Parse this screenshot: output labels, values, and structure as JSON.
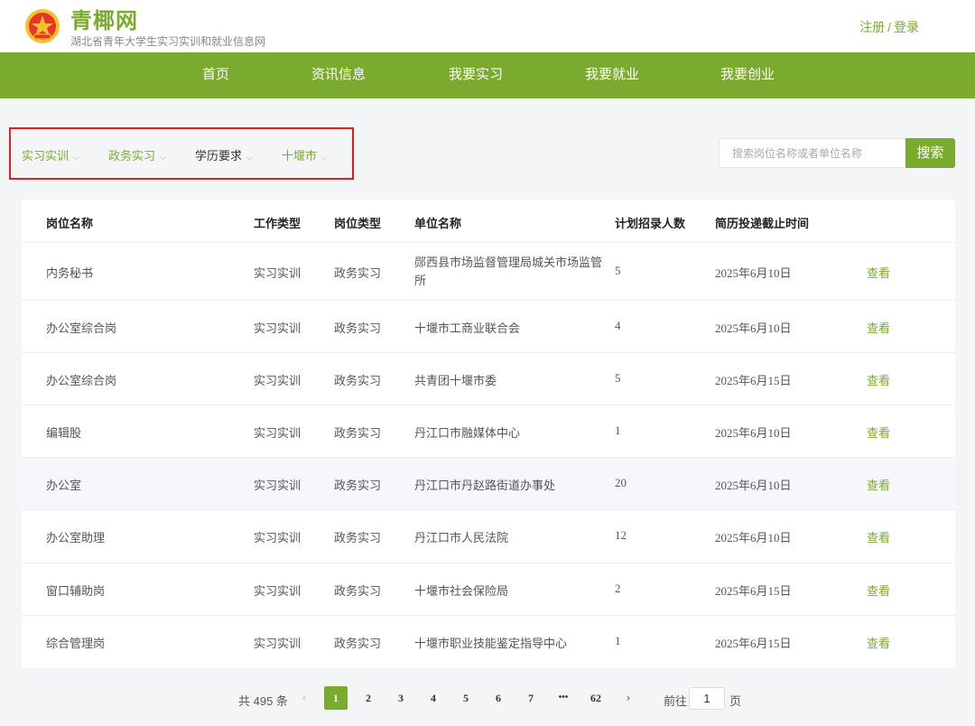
{
  "brand": {
    "name": "青椰网",
    "subtitle": "湖北省青年大学生实习实训和就业信息网",
    "accent": "#7aab2e"
  },
  "auth": {
    "register": "注册",
    "separator": "/",
    "login": "登录"
  },
  "nav": [
    "首页",
    "资讯信息",
    "我要实习",
    "我要就业",
    "我要创业"
  ],
  "filters": [
    "实习实训",
    "政务实习",
    "学历要求",
    "十堰市"
  ],
  "search": {
    "placeholder": "搜索岗位名称或者单位名称",
    "button": "搜索"
  },
  "table": {
    "headers": [
      "岗位名称",
      "工作类型",
      "岗位类型",
      "单位名称",
      "计划招录人数",
      "简历投递截止时间"
    ],
    "action": "查看",
    "rows": [
      {
        "post": "内务秘书",
        "work_type": "实习实训",
        "post_type": "政务实习",
        "org": "郧西县市场监督管理局城关市场监管所",
        "count": "5",
        "deadline": "2025年6月10日"
      },
      {
        "post": "办公室综合岗",
        "work_type": "实习实训",
        "post_type": "政务实习",
        "org": "十堰市工商业联合会",
        "count": "4",
        "deadline": "2025年6月10日"
      },
      {
        "post": "办公室综合岗",
        "work_type": "实习实训",
        "post_type": "政务实习",
        "org": "共青团十堰市委",
        "count": "5",
        "deadline": "2025年6月15日"
      },
      {
        "post": "编辑股",
        "work_type": "实习实训",
        "post_type": "政务实习",
        "org": "丹江口市融媒体中心",
        "count": "1",
        "deadline": "2025年6月10日"
      },
      {
        "post": "办公室",
        "work_type": "实习实训",
        "post_type": "政务实习",
        "org": "丹江口市丹赵路街道办事处",
        "count": "20",
        "deadline": "2025年6月10日"
      },
      {
        "post": "办公室助理",
        "work_type": "实习实训",
        "post_type": "政务实习",
        "org": "丹江口市人民法院",
        "count": "12",
        "deadline": "2025年6月10日"
      },
      {
        "post": "窗口辅助岗",
        "work_type": "实习实训",
        "post_type": "政务实习",
        "org": "十堰市社会保险局",
        "count": "2",
        "deadline": "2025年6月15日"
      },
      {
        "post": "综合管理岗",
        "work_type": "实习实训",
        "post_type": "政务实习",
        "org": "十堰市职业技能鉴定指导中心",
        "count": "1",
        "deadline": "2025年6月15日"
      }
    ]
  },
  "pagination": {
    "total_text": "共 495 条",
    "prev": "‹",
    "next": "›",
    "pages": [
      "1",
      "2",
      "3",
      "4",
      "5",
      "6",
      "7",
      "•••",
      "62"
    ],
    "current": "1",
    "goto_label": "前往",
    "goto_value": "1",
    "goto_suffix": "页"
  }
}
